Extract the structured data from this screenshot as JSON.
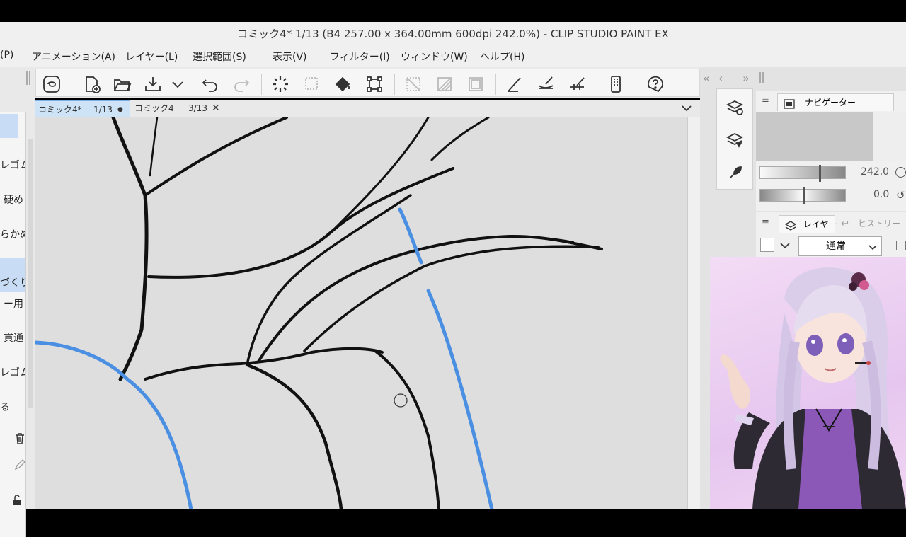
{
  "window": {
    "title": "コミック4* 1/13 (B4 257.00 x 364.00mm 600dpi 242.0%)  - CLIP STUDIO PAINT EX"
  },
  "menu": [
    {
      "label": "(P)"
    },
    {
      "label": "アニメーション(A)"
    },
    {
      "label": "レイヤー(L)"
    },
    {
      "label": "選択範囲(S)"
    },
    {
      "label": "表示(V)"
    },
    {
      "label": "フィルター(I)"
    },
    {
      "label": "ウィンドウ(W)"
    },
    {
      "label": "ヘルプ(H)"
    }
  ],
  "toolbar": {
    "icons": [
      "clip-studio-icon",
      "new-file-icon",
      "open-folder-icon",
      "save-icon",
      "dropdown-icon",
      "undo-icon",
      "redo-icon",
      "loading-icon",
      "clear-selection-icon",
      "fill-icon",
      "transform-icon",
      "ruler-off-icon",
      "hatch-icon",
      "frame-icon",
      "pen-line-icon",
      "brush-icon",
      "ruler-icon",
      "device-icon",
      "help-icon"
    ]
  },
  "tabs": [
    {
      "name": "コミック4*",
      "page": "1/13",
      "marker": "●"
    },
    {
      "name": "コミック4",
      "page": "3/13",
      "marker": "✕"
    }
  ],
  "left_panel": {
    "items": [
      "レゴム",
      "硬め",
      "らかめ",
      "づくり",
      "ー用",
      "貫通",
      "レゴム",
      "る"
    ]
  },
  "navigator": {
    "tab_label": "ナビゲーター",
    "zoom_value": "242.0",
    "rotation_value": "0.0",
    "zoom_fraction": 0.69,
    "rotation_fraction": 0.5
  },
  "layers": {
    "tab_label": "レイヤー",
    "history_label": "ヒストリー",
    "blend_mode": "通常"
  },
  "colors": {
    "accent": "#7ab0e6",
    "selection": "#c8ddf5",
    "stroke_blue": "#4a8fe2"
  }
}
